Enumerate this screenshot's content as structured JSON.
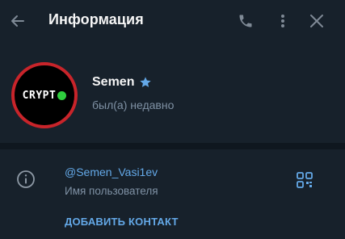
{
  "header": {
    "title": "Информация",
    "icons": [
      "back-arrow-icon",
      "phone-icon",
      "more-vertical-icon",
      "close-icon"
    ]
  },
  "profile": {
    "avatar_text": "CRYPT",
    "name": "Semen",
    "status": "был(а) недавно",
    "badge_icon": "star-icon"
  },
  "info": {
    "username": "@Semen_Vasi1ev",
    "username_label": "Имя пользователя",
    "add_contact": "ДОБАВИТЬ КОНТАКТ"
  },
  "colors": {
    "background": "#17212b",
    "divider": "#0f171f",
    "accent": "#64a9e8",
    "secondary_text": "#7f91a4",
    "avatar_ring": "#c8242a",
    "online_dot": "#2fce3e"
  }
}
